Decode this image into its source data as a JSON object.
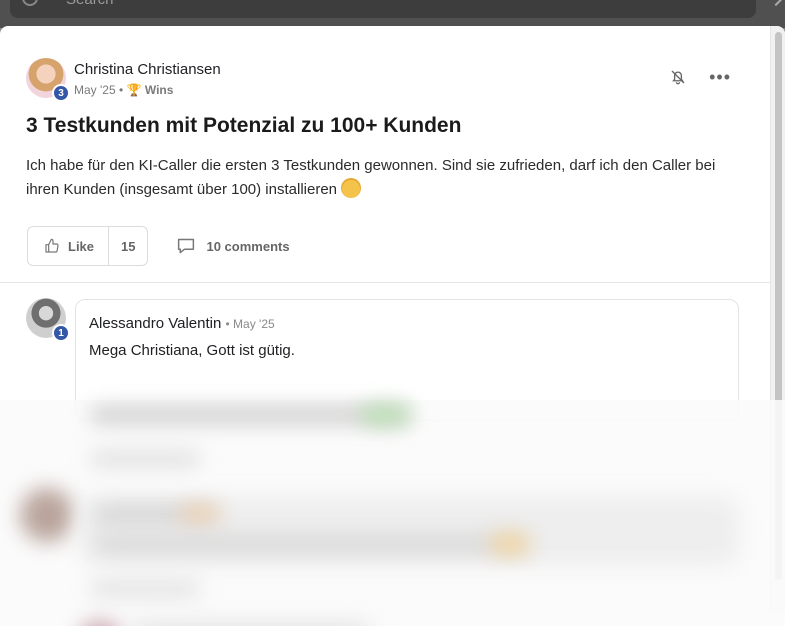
{
  "search": {
    "placeholder": "Search"
  },
  "post": {
    "author": "Christina Christiansen",
    "author_level": "3",
    "date": "May '25",
    "category": "Wins",
    "title": "3 Testkunden mit Potenzial zu 100+ Kunden",
    "body": "Ich habe für den KI-Caller die ersten 3 Testkunden gewonnen. Sind sie zufrieden, darf ich den Caller bei ihren Kunden (insgesamt über 100) installieren",
    "like_label": "Like",
    "like_count": "15",
    "comments_label": "10 comments"
  },
  "comment": {
    "author": "Alessandro Valentin",
    "author_level": "1",
    "date": "May '25",
    "text": "Mega Christiana, Gott ist gütig."
  },
  "icons": {
    "search": "search-icon",
    "bell": "bell-off-icon",
    "more": "more-horizontal-icon",
    "like": "thumbs-up-icon",
    "comment": "comment-icon",
    "trophy": "trophy-icon",
    "emoji": "smiling-face-with-hearts-emoji"
  }
}
